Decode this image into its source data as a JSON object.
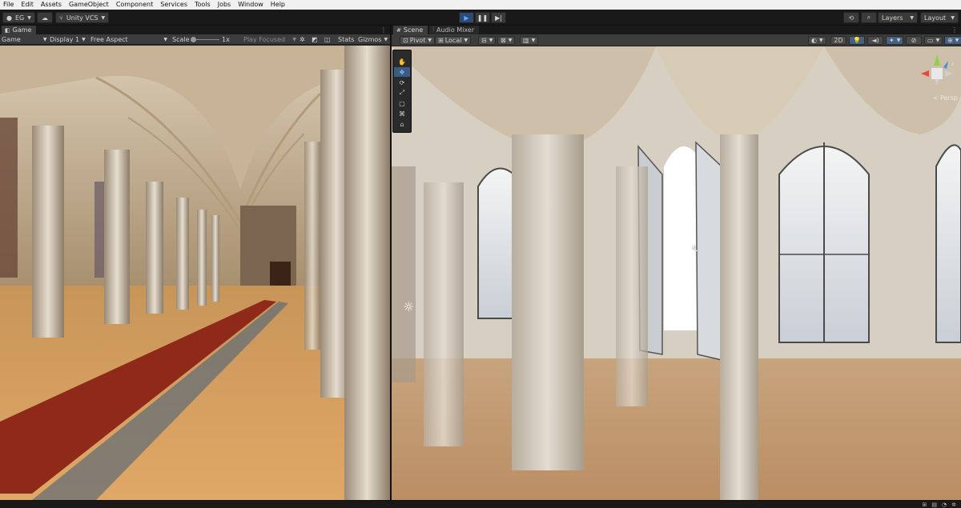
{
  "menu": [
    "File",
    "Edit",
    "Assets",
    "GameObject",
    "Component",
    "Services",
    "Tools",
    "Jobs",
    "Window",
    "Help"
  ],
  "toolbar": {
    "account": "EG",
    "vcs": "Unity VCS",
    "layers": "Layers",
    "layout": "Layout"
  },
  "game_panel": {
    "tab": "Game",
    "mode": "Game",
    "display": "Display 1",
    "aspect": "Free Aspect",
    "scale_label": "Scale",
    "scale_value": "1x",
    "play_focused": "Play Focused",
    "stats": "Stats",
    "gizmos": "Gizmos"
  },
  "scene_panel": {
    "tabs": [
      "Scene",
      "Audio Mixer"
    ],
    "pivot": "Pivot",
    "local": "Local",
    "mode_2d": "2D",
    "persp": "< Persp"
  },
  "colors": {
    "accent": "#5ea8ff",
    "carpet": "#8f2a1a"
  }
}
